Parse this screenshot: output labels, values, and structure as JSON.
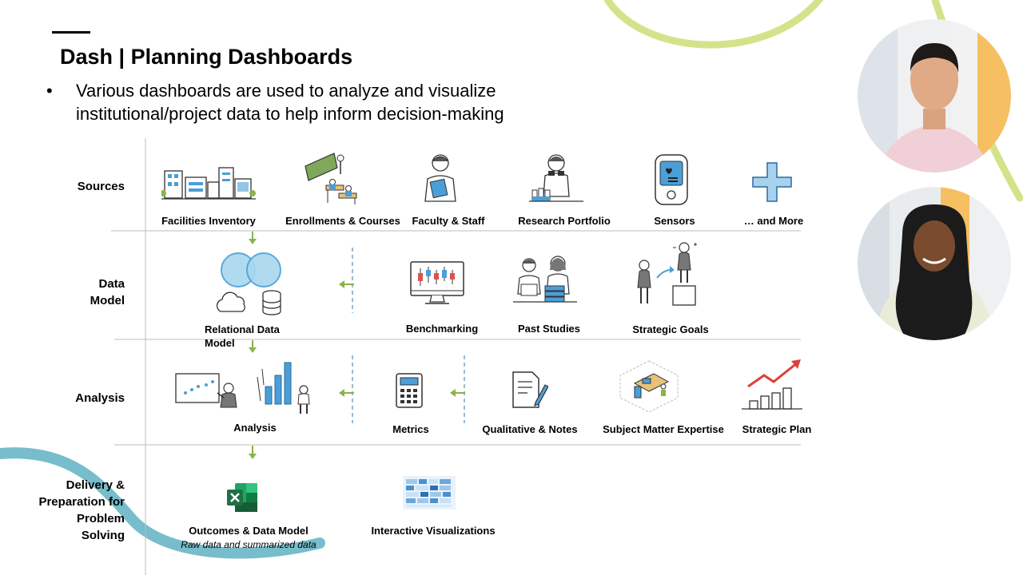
{
  "slide": {
    "title": "Dash | Planning Dashboards",
    "bullet": "Various dashboards are used to analyze and visualize institutional/project data to help inform decision-making"
  },
  "rows": [
    {
      "label": "Sources"
    },
    {
      "label": "Data Model"
    },
    {
      "label": "Analysis"
    },
    {
      "label": "Delivery & Preparation for Problem Solving"
    }
  ],
  "sources": {
    "items": [
      {
        "label": "Facilities Inventory",
        "icon": "buildings-icon"
      },
      {
        "label": "Enrollments & Courses",
        "icon": "classroom-icon"
      },
      {
        "label": "Faculty & Staff",
        "icon": "faculty-person-icon"
      },
      {
        "label": "Research Portfolio",
        "icon": "researcher-icon"
      },
      {
        "label": "Sensors",
        "icon": "sensor-device-icon"
      },
      {
        "label": "… and More",
        "icon": "plus-icon"
      }
    ]
  },
  "data_model": {
    "items": [
      {
        "label": "Relational Data Model",
        "icon": "venn-database-icon"
      },
      {
        "label": "Benchmarking",
        "icon": "monitor-chart-icon"
      },
      {
        "label": "Past Studies",
        "icon": "studying-people-icon"
      },
      {
        "label": "Strategic Goals",
        "icon": "goal-climb-icon"
      }
    ]
  },
  "analysis": {
    "items": [
      {
        "label": "Analysis",
        "icon": "analysis-charts-icon"
      },
      {
        "label": "Metrics",
        "icon": "calculator-icon"
      },
      {
        "label": "Qualitative & Notes",
        "icon": "notes-pen-icon"
      },
      {
        "label": "Subject Matter Expertise",
        "icon": "workspace-icon"
      },
      {
        "label": "Strategic Plan",
        "icon": "growth-chart-icon"
      }
    ]
  },
  "delivery": {
    "items": [
      {
        "label": "Outcomes & Data Model",
        "sublabel": "Raw data and summarized data",
        "icon": "excel-icon"
      },
      {
        "label": "Interactive Visualizations",
        "icon": "heatmap-icon"
      }
    ]
  },
  "colors": {
    "arrow_green": "#8ab34a",
    "dashed_blue": "#5b8db8",
    "deco_lime": "#d4e38a",
    "deco_teal": "#5fb2c2",
    "excel_green": "#1e7145",
    "sensor_blue": "#4a9fd8"
  }
}
